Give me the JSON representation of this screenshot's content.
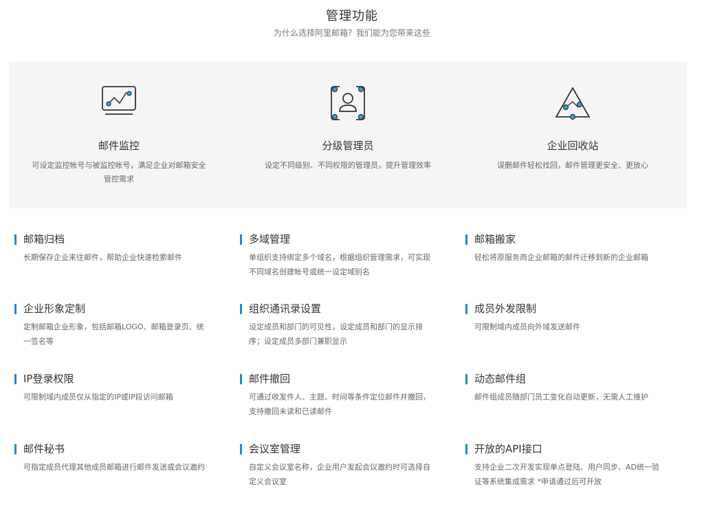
{
  "header": {
    "title": "管理功能",
    "subtitle": "为什么选择阿里邮箱？我们能为您带来这些"
  },
  "features": [
    {
      "icon": "monitor-chart-icon",
      "title": "邮件监控",
      "desc": "可设定监控帐号与被监控帐号，满足企业对邮箱安全管控需求"
    },
    {
      "icon": "admin-user-icon",
      "title": "分级管理员",
      "desc": "设定不同级别、不同权限的管理员，提升管理效率"
    },
    {
      "icon": "recycle-triangle-icon",
      "title": "企业回收站",
      "desc": "误删邮件轻松找回，邮件管理更安全、更放心"
    }
  ],
  "items": [
    {
      "title": "邮箱归档",
      "desc": "长期保存企业来往邮件，帮助企业快速检索邮件"
    },
    {
      "title": "多域管理",
      "desc": "单组织支持绑定多个域名，根据组织管理需求，可实现不同域名创建帐号或统一设定域别名"
    },
    {
      "title": "邮箱搬家",
      "desc": "轻松将原服务商企业邮箱的邮件迁移到新的企业邮箱"
    },
    {
      "title": "企业形象定制",
      "desc": "定制邮箱企业形象，包括邮箱LOGO、邮箱登录页、统一签名等"
    },
    {
      "title": "组织通讯录设置",
      "desc": "设定成员和部门的可见性，设定成员和部门的显示排序；设定成员多部门兼职显示"
    },
    {
      "title": "成员外发限制",
      "desc": "可限制域内成员向外域发送邮件"
    },
    {
      "title": "IP登录权限",
      "desc": "可限制域内成员仅从指定的IP或IP段访问邮箱"
    },
    {
      "title": "邮件撤回",
      "desc": "可通过收发件人、主题、时间等条件定位邮件并撤回，支持撤回未读和已读邮件"
    },
    {
      "title": "动态邮件组",
      "desc": "邮件组成员随部门员工变化自动更新，无需人工维护"
    },
    {
      "title": "邮件秘书",
      "desc": "可指定成员代理其他成员邮箱进行邮件发送或会议邀约"
    },
    {
      "title": "会议室管理",
      "desc": "自定义会议室名称，企业用户发起会议邀约时可选择自定义会议室"
    },
    {
      "title": "开放的API接口",
      "desc": "支持企业二次开发实现单点登陆、用户同步、AD统一验证等系统集成需求 *申请通过后可开放"
    }
  ],
  "colors": {
    "accent": "#1f8ad1",
    "icon_dot": "#29a9d6",
    "icon_stroke": "#333333"
  }
}
